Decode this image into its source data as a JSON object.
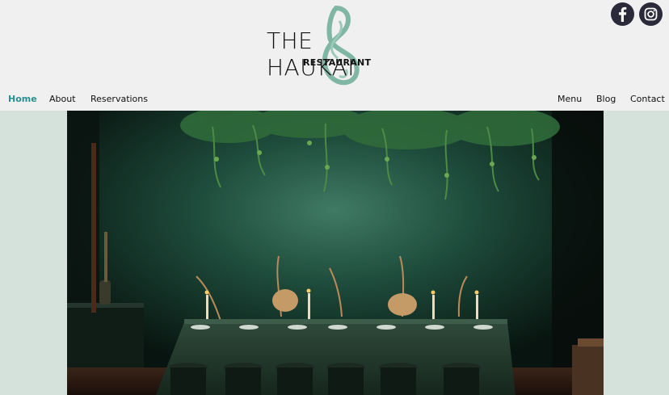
{
  "brand": {
    "title": "THE HAUKAI",
    "subtitle": "RESTAURANT",
    "mark_color": "#7fb7a4"
  },
  "social": [
    {
      "icon": "facebook-icon"
    },
    {
      "icon": "instagram-icon"
    }
  ],
  "nav": {
    "left": [
      {
        "label": "Home",
        "active": true
      },
      {
        "label": "About"
      },
      {
        "label": "Reservations"
      }
    ],
    "right": [
      {
        "label": "Menu"
      },
      {
        "label": "Blog"
      },
      {
        "label": "Contact"
      }
    ]
  },
  "colors": {
    "accent": "#2b8f8f",
    "header_bg": "#f0f0f0",
    "section_bg": "#d5e2dc",
    "social_bg": "#2a2a3a"
  },
  "hero": {
    "image": "dark green dining room with long candle-lit table and hanging plants"
  }
}
